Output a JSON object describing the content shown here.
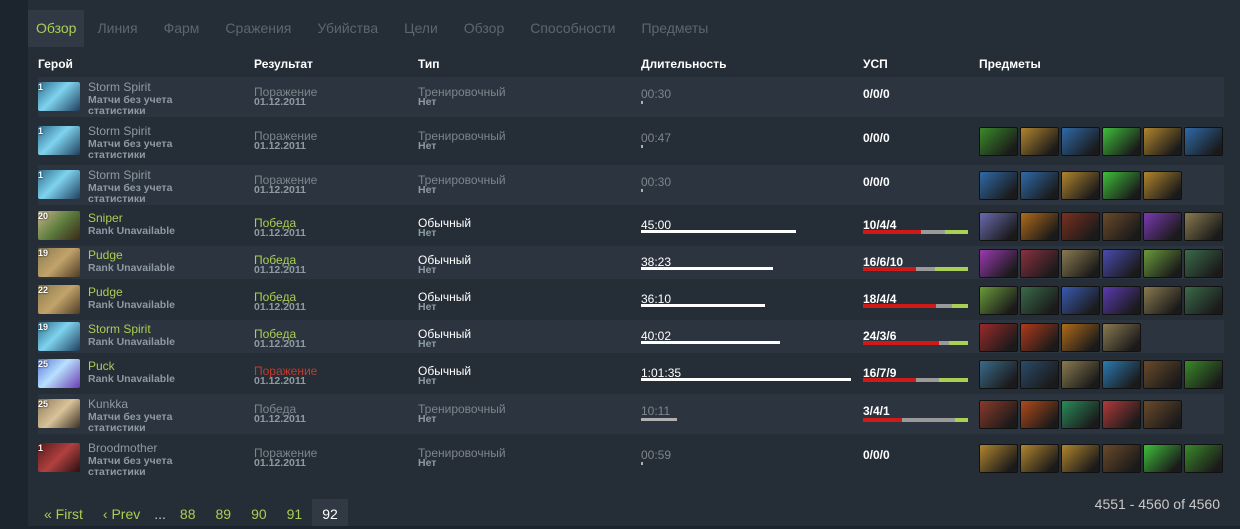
{
  "tabs": [
    {
      "label": "Обзор",
      "active": true
    },
    {
      "label": "Линия"
    },
    {
      "label": "Фарм"
    },
    {
      "label": "Сражения"
    },
    {
      "label": "Убийства"
    },
    {
      "label": "Цели"
    },
    {
      "label": "Обзор"
    },
    {
      "label": "Способности"
    },
    {
      "label": "Предметы"
    }
  ],
  "headers": {
    "hero": "Герой",
    "result": "Результат",
    "type": "Тип",
    "duration": "Длительность",
    "kda": "УСП",
    "items": "Предметы"
  },
  "matches": [
    {
      "level": "1",
      "hero": "Storm Spirit",
      "hero_class": "storm",
      "sub": "Матчи без учета статистики",
      "result": "Поражение",
      "result_state": "plain",
      "date": "01.12.2011",
      "type": "Тренировочный",
      "ranked": false,
      "lobby": "Нет",
      "duration": "00:30",
      "duration_fraction": 0.008,
      "kda": "0/0/0",
      "kda_values": [
        0,
        0,
        0
      ],
      "items": []
    },
    {
      "level": "1",
      "hero": "Storm Spirit",
      "hero_class": "storm",
      "sub": "Матчи без учета статистики",
      "result": "Поражение",
      "result_state": "plain",
      "date": "01.12.2011",
      "type": "Тренировочный",
      "ranked": false,
      "lobby": "Нет",
      "duration": "00:47",
      "duration_fraction": 0.008,
      "kda": "0/0/0",
      "kda_values": [
        0,
        0,
        0
      ],
      "items": [
        "#3a8a2a",
        "#b0852d",
        "#2f6aa8",
        "#3fbf3a",
        "#b0852d",
        "#2f6aa8"
      ]
    },
    {
      "level": "1",
      "hero": "Storm Spirit",
      "hero_class": "storm",
      "sub": "Матчи без учета статистики",
      "result": "Поражение",
      "result_state": "plain",
      "date": "01.12.2011",
      "type": "Тренировочный",
      "ranked": false,
      "lobby": "Нет",
      "duration": "00:30",
      "duration_fraction": 0.008,
      "kda": "0/0/0",
      "kda_values": [
        0,
        0,
        0
      ],
      "items": [
        "#2f6aa8",
        "#2f6aa8",
        "#b0852d",
        "#3fbf3a",
        "#b0852d"
      ]
    },
    {
      "level": "20",
      "hero": "Sniper",
      "hero_class": "sniper",
      "sub": "Rank Unavailable",
      "result": "Победа",
      "result_state": "win",
      "date": "01.12.2011",
      "type": "Обычный",
      "ranked": true,
      "lobby": "Нет",
      "duration": "45:00",
      "duration_fraction": 0.74,
      "kda": "10/4/4",
      "kda_values": [
        10,
        4,
        4
      ],
      "items": [
        "#6a6ab0",
        "#b06a1a",
        "#7a3020",
        "#6a4a2a",
        "#7a3ab0",
        "#8a7a50"
      ]
    },
    {
      "level": "19",
      "hero": "Pudge",
      "hero_class": "pudge",
      "sub": "Rank Unavailable",
      "result": "Победа",
      "result_state": "win",
      "date": "01.12.2011",
      "type": "Обычный",
      "ranked": true,
      "lobby": "Нет",
      "duration": "38:23",
      "duration_fraction": 0.63,
      "kda": "16/6/10",
      "kda_values": [
        16,
        6,
        10
      ],
      "items": [
        "#9a3ab0",
        "#8a3040",
        "#8a7a50",
        "#4a4ab0",
        "#6a9a3a",
        "#3a6a4a"
      ]
    },
    {
      "level": "22",
      "hero": "Pudge",
      "hero_class": "pudge",
      "sub": "Rank Unavailable",
      "result": "Победа",
      "result_state": "win",
      "date": "01.12.2011",
      "type": "Обычный",
      "ranked": true,
      "lobby": "Нет",
      "duration": "36:10",
      "duration_fraction": 0.59,
      "kda": "18/4/4",
      "kda_values": [
        18,
        4,
        4
      ],
      "items": [
        "#6a9a3a",
        "#3a6a4a",
        "#3a5ab0",
        "#5a3ab0",
        "#8a7a50",
        "#3a6a4a"
      ]
    },
    {
      "level": "19",
      "hero": "Storm Spirit",
      "hero_class": "storm",
      "sub": "Rank Unavailable",
      "result": "Победа",
      "result_state": "win",
      "date": "01.12.2011",
      "type": "Обычный",
      "ranked": true,
      "lobby": "Нет",
      "duration": "40:02",
      "duration_fraction": 0.66,
      "kda": "24/3/6",
      "kda_values": [
        24,
        3,
        6
      ],
      "items": [
        "#9a2a2a",
        "#b03a1a",
        "#b06a1a",
        "#8a7a50"
      ]
    },
    {
      "level": "25",
      "hero": "Puck",
      "hero_class": "puck",
      "sub": "Rank Unavailable",
      "result": "Поражение",
      "result_state": "loss",
      "date": "01.12.2011",
      "type": "Обычный",
      "ranked": true,
      "lobby": "Нет",
      "duration": "1:01:35",
      "duration_fraction": 1.0,
      "kda": "16/7/9",
      "kda_values": [
        16,
        7,
        9
      ],
      "items": [
        "#3a6a8a",
        "#2a4a6a",
        "#8a7a50",
        "#2a7ab0",
        "#6a4a2a",
        "#3a8a2a"
      ]
    },
    {
      "level": "25",
      "hero": "Kunkka",
      "hero_class": "kunkka",
      "sub": "Матчи без учета статистики",
      "result": "Победа",
      "result_state": "plain",
      "date": "01.12.2011",
      "type": "Тренировочный",
      "ranked": false,
      "lobby": "Нет",
      "duration": "10:11",
      "duration_fraction": 0.17,
      "kda": "3/4/1",
      "kda_values": [
        3,
        4,
        1
      ],
      "items": [
        "#8a3a2a",
        "#b04a1a",
        "#2a8a5a",
        "#b03a3a",
        "#6a4a2a"
      ]
    },
    {
      "level": "1",
      "hero": "Broodmother",
      "hero_class": "brood",
      "sub": "Матчи без учета статистики",
      "result": "Поражение",
      "result_state": "plain",
      "date": "01.12.2011",
      "type": "Тренировочный",
      "ranked": false,
      "lobby": "Нет",
      "duration": "00:59",
      "duration_fraction": 0.008,
      "kda": "0/0/0",
      "kda_values": [
        0,
        0,
        0
      ],
      "items": [
        "#b0852d",
        "#b0852d",
        "#b0852d",
        "#6a4a2a",
        "#3fbf3a",
        "#3a8a2a"
      ]
    }
  ],
  "pager": {
    "first": "« First",
    "prev": "‹ Prev",
    "dots": "...",
    "pages": [
      "88",
      "89",
      "90",
      "91",
      "92"
    ],
    "current": "92"
  },
  "count": "4551 - 4560 of 4560"
}
